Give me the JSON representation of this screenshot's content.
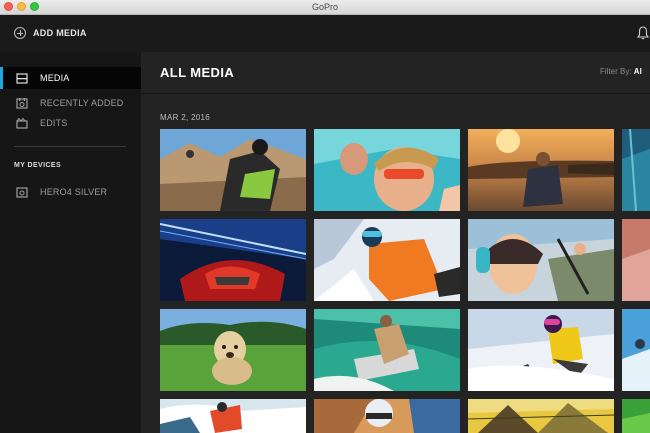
{
  "window": {
    "title": "GoPro"
  },
  "toolbar": {
    "add_media_label": "ADD MEDIA"
  },
  "sidebar": {
    "items": [
      {
        "label": "MEDIA",
        "icon": "media-icon",
        "active": true
      },
      {
        "label": "RECENTLY ADDED",
        "icon": "recently-added-icon",
        "active": false
      },
      {
        "label": "EDITS",
        "icon": "edits-icon",
        "active": false
      }
    ],
    "devices_heading": "MY DEVICES",
    "devices": [
      {
        "label": "HERO4 SILVER",
        "icon": "camera-device-icon"
      }
    ]
  },
  "main": {
    "title": "ALL MEDIA",
    "filter_label": "Filter By:",
    "filter_value": "Al",
    "date_group": "MAR 2, 2016"
  },
  "colors": {
    "accent": "#1fa6e0",
    "sidebar_bg": "#161616",
    "main_bg": "#232323"
  }
}
